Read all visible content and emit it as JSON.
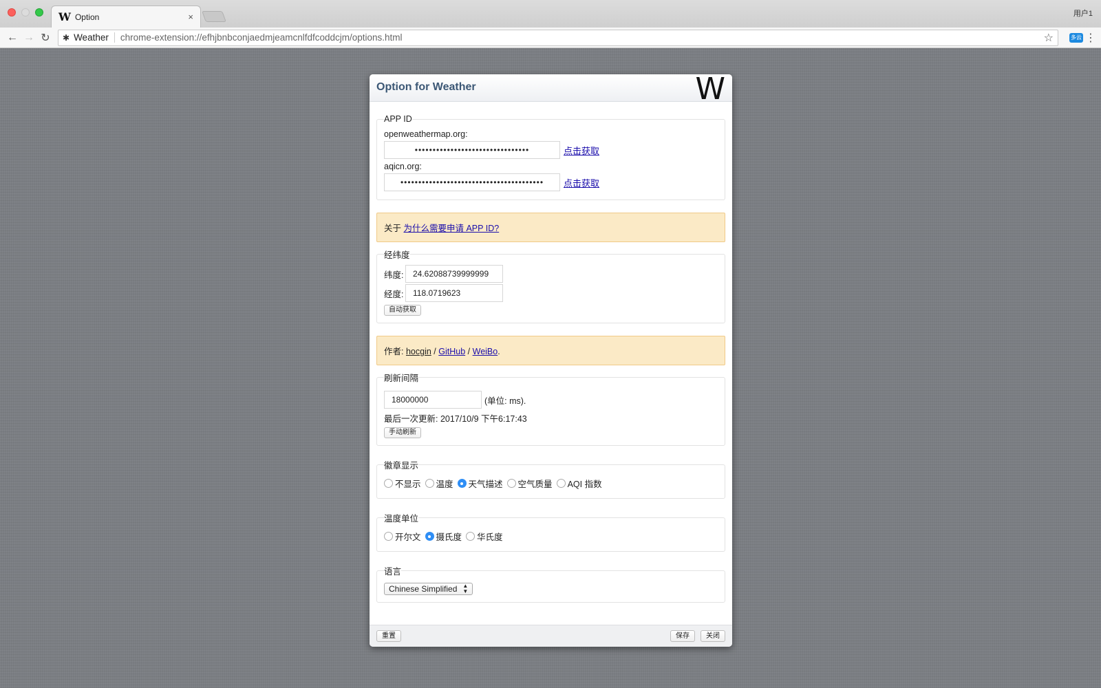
{
  "browser": {
    "tab_title": "Option",
    "tab_icon": "W",
    "tab_close": "×",
    "user_label": "用户1",
    "site_label": "Weather",
    "url": "chrome-extension://efhjbnbconjaedmjeamcnlfdfcoddcjm/options.html",
    "ext_badge": "多云"
  },
  "dialog": {
    "title": "Option for Weather",
    "logo": "W",
    "app_id": {
      "legend": "APP ID",
      "owm_label": "openweathermap.org:",
      "owm_value": "••••••••••••••••••••••••••••••••",
      "owm_link": "点击获取",
      "aqicn_label": "aqicn.org:",
      "aqicn_value": "••••••••••••••••••••••••••••••••••••••••",
      "aqicn_link": "点击获取"
    },
    "about_note": {
      "prefix": "关于",
      "link": "为什么需要申请 APP ID?"
    },
    "coords": {
      "legend": "经纬度",
      "lat_label": "纬度:",
      "lat_value": "24.62088739999999",
      "lng_label": "经度:",
      "lng_value": "118.0719623",
      "auto_button": "自动获取"
    },
    "author_note": {
      "prefix": "作者:",
      "author": "hocgin",
      "sep1": "/",
      "github": "GitHub",
      "sep2": "/",
      "weibo": "WeiBo",
      "suffix": "."
    },
    "refresh": {
      "legend": "刷新间隔",
      "interval_value": "18000000",
      "unit": "(单位: ms).",
      "last_update": "最后一次更新: 2017/10/9 下午6:17:43",
      "manual_button": "手动刷新"
    },
    "badge": {
      "legend": "徽章显示",
      "options": [
        {
          "label": "不显示",
          "checked": false
        },
        {
          "label": "温度",
          "checked": false
        },
        {
          "label": "天气描述",
          "checked": true
        },
        {
          "label": "空气质量",
          "checked": false
        },
        {
          "label": "AQI 指数",
          "checked": false
        }
      ]
    },
    "temp_unit": {
      "legend": "温度单位",
      "options": [
        {
          "label": "开尔文",
          "checked": false
        },
        {
          "label": "摄氏度",
          "checked": true
        },
        {
          "label": "华氏度",
          "checked": false
        }
      ]
    },
    "language": {
      "legend": "语言",
      "selected": "Chinese Simplified"
    },
    "footer": {
      "reset": "重置",
      "save": "保存",
      "close": "关闭"
    }
  },
  "colors": {
    "title_text": "#3b5775",
    "note_bg": "#fbeac6",
    "note_border": "#f0c987",
    "link": "#1a0dab",
    "radio_selected": "#2f8ef5"
  }
}
